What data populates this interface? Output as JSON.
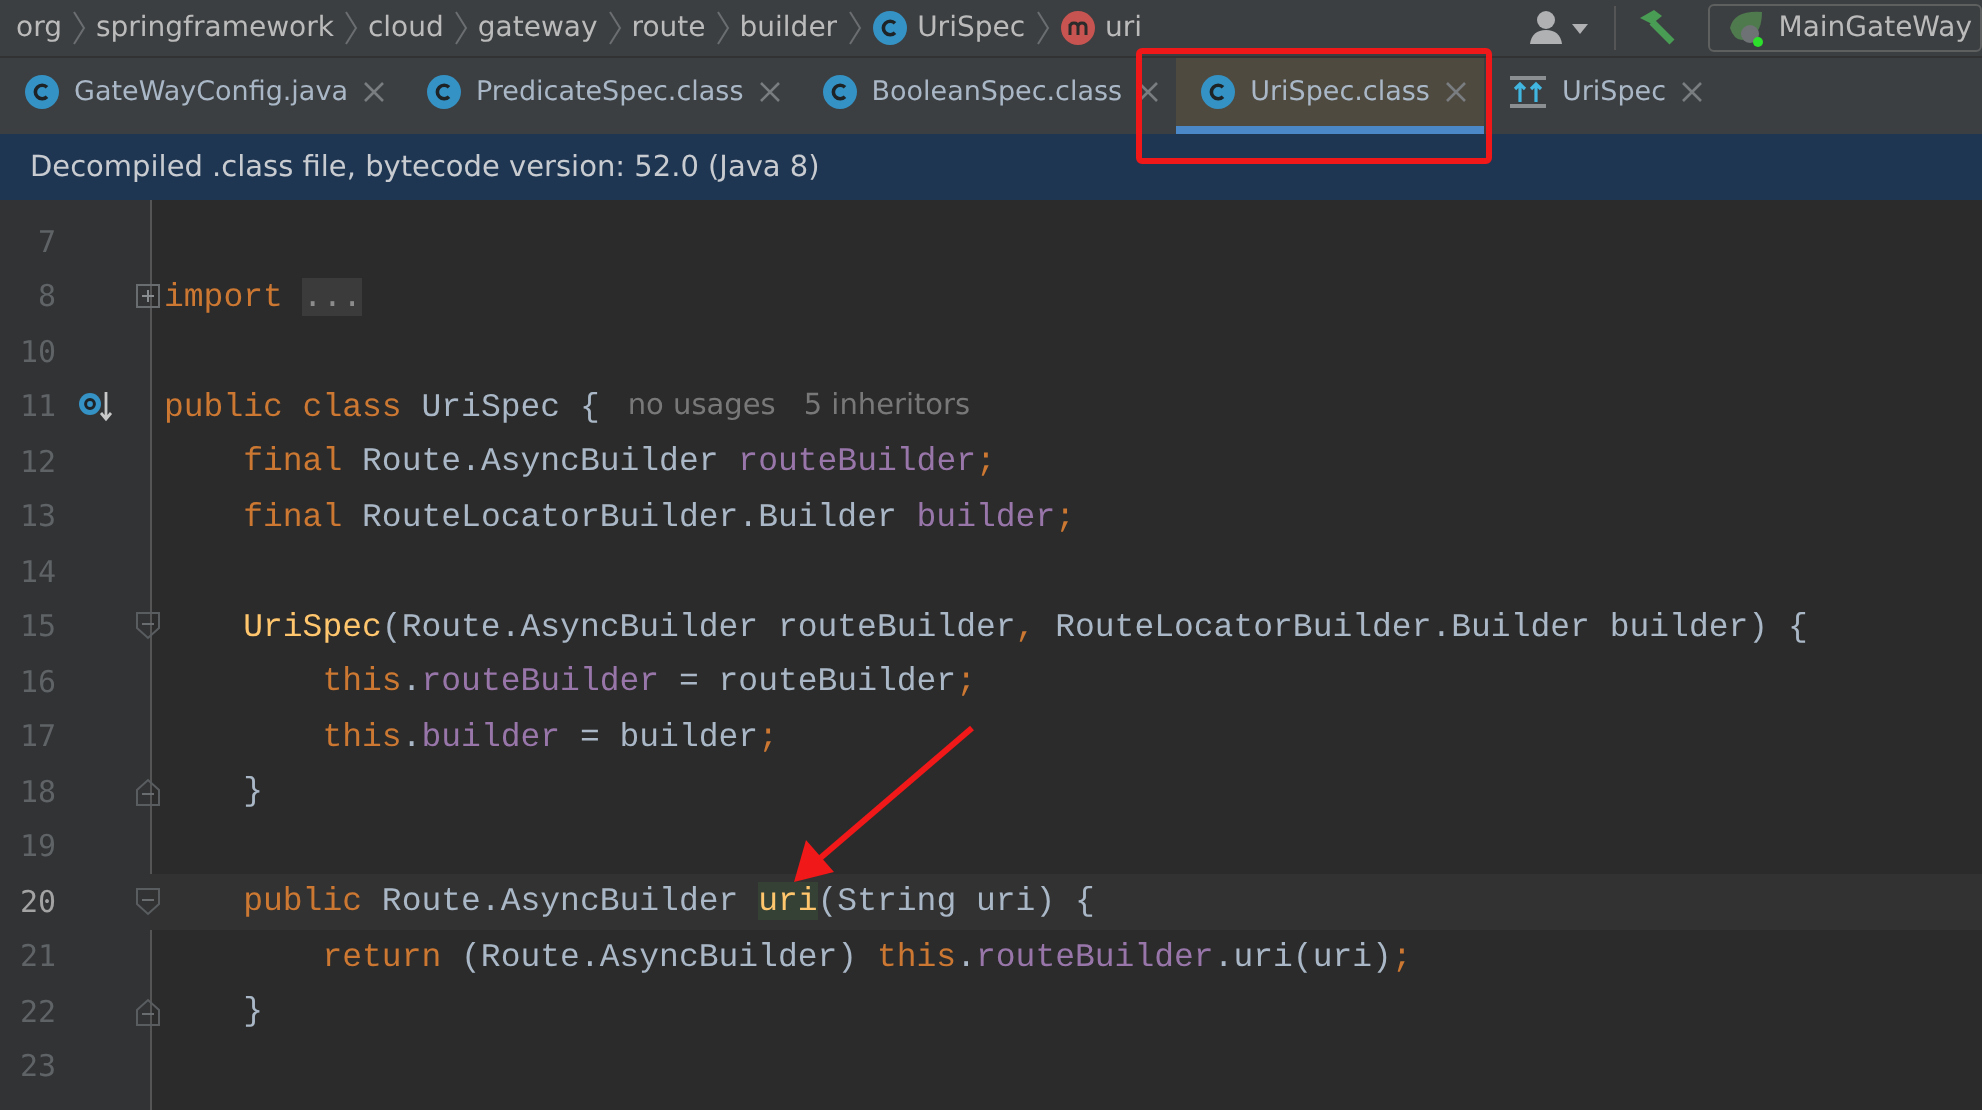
{
  "breadcrumbs": [
    {
      "label": "org"
    },
    {
      "label": "springframework"
    },
    {
      "label": "cloud"
    },
    {
      "label": "gateway"
    },
    {
      "label": "route"
    },
    {
      "label": "builder"
    },
    {
      "label": "UriSpec",
      "kind": "class"
    },
    {
      "label": "uri",
      "kind": "method"
    }
  ],
  "run_config": {
    "label": "MainGateWay"
  },
  "tabs": [
    {
      "label": "GateWayConfig.java",
      "kind": "class",
      "selected": false,
      "outlined": false
    },
    {
      "label": "PredicateSpec.class",
      "kind": "class",
      "selected": false,
      "outlined": false
    },
    {
      "label": "BooleanSpec.class",
      "kind": "class",
      "selected": false,
      "outlined": false
    },
    {
      "label": "UriSpec.class",
      "kind": "class",
      "selected": true,
      "outlined": true
    },
    {
      "label": "UriSpec",
      "kind": "structure",
      "selected": false,
      "outlined": false
    }
  ],
  "banner": "Decompiled .class file, bytecode version: 52.0 (Java 8)",
  "code_lines": [
    {
      "number": "7",
      "current": false,
      "kind": "plain"
    },
    {
      "number": "8",
      "current": false,
      "kind": "fold_plus",
      "tokens": [
        {
          "kind": "keyword",
          "text": "import "
        },
        {
          "kind": "folded",
          "text": "..."
        }
      ]
    },
    {
      "number": "10",
      "current": false,
      "kind": "plain"
    },
    {
      "number": "11",
      "current": false,
      "kind": "implemented",
      "tokens": [
        {
          "kind": "keyword",
          "text": "public class "
        },
        {
          "kind": "plain",
          "text": "UriSpec {"
        }
      ],
      "hints": [
        "no usages",
        "5 inheritors"
      ]
    },
    {
      "number": "12",
      "current": false,
      "kind": "plain",
      "tokens": [
        {
          "kind": "keyword",
          "text": "    final "
        },
        {
          "kind": "plain",
          "text": "Route.AsyncBuilder "
        },
        {
          "kind": "field",
          "text": "routeBuilder"
        },
        {
          "kind": "keyword",
          "text": ";"
        }
      ]
    },
    {
      "number": "13",
      "current": false,
      "kind": "plain",
      "tokens": [
        {
          "kind": "keyword",
          "text": "    final "
        },
        {
          "kind": "plain",
          "text": "RouteLocatorBuilder.Builder "
        },
        {
          "kind": "field",
          "text": "builder"
        },
        {
          "kind": "keyword",
          "text": ";"
        }
      ]
    },
    {
      "number": "14",
      "current": false,
      "kind": "plain"
    },
    {
      "number": "15",
      "current": false,
      "kind": "fold_start",
      "tokens": [
        {
          "kind": "method",
          "text": "    UriSpec"
        },
        {
          "kind": "plain",
          "text": "(Route.AsyncBuilder routeBuilder"
        },
        {
          "kind": "keyword",
          "text": ", "
        },
        {
          "kind": "plain",
          "text": "RouteLocatorBuilder.Builder builder) {"
        }
      ]
    },
    {
      "number": "16",
      "current": false,
      "kind": "plain",
      "tokens": [
        {
          "kind": "keyword",
          "text": "        this"
        },
        {
          "kind": "plain",
          "text": "."
        },
        {
          "kind": "field",
          "text": "routeBuilder"
        },
        {
          "kind": "plain",
          "text": " = routeBuilder"
        },
        {
          "kind": "keyword",
          "text": ";"
        }
      ]
    },
    {
      "number": "17",
      "current": false,
      "kind": "plain",
      "tokens": [
        {
          "kind": "keyword",
          "text": "        this"
        },
        {
          "kind": "plain",
          "text": "."
        },
        {
          "kind": "field",
          "text": "builder"
        },
        {
          "kind": "plain",
          "text": " = builder"
        },
        {
          "kind": "keyword",
          "text": ";"
        }
      ]
    },
    {
      "number": "18",
      "current": false,
      "kind": "fold_end",
      "tokens": [
        {
          "kind": "plain",
          "text": "    }"
        }
      ]
    },
    {
      "number": "19",
      "current": false,
      "kind": "plain"
    },
    {
      "number": "20",
      "current": true,
      "kind": "fold_start",
      "tokens": [
        {
          "kind": "keyword",
          "text": "    public "
        },
        {
          "kind": "plain",
          "text": "Route.AsyncBuilder "
        },
        {
          "kind": "method_hl",
          "text": "uri"
        },
        {
          "kind": "plain",
          "text": "(String uri) {"
        }
      ]
    },
    {
      "number": "21",
      "current": false,
      "kind": "plain",
      "tokens": [
        {
          "kind": "keyword",
          "text": "        return "
        },
        {
          "kind": "plain",
          "text": "(Route.AsyncBuilder) "
        },
        {
          "kind": "keyword",
          "text": "this"
        },
        {
          "kind": "plain",
          "text": "."
        },
        {
          "kind": "field",
          "text": "routeBuilder"
        },
        {
          "kind": "plain",
          "text": ".uri(uri)"
        },
        {
          "kind": "keyword",
          "text": ";"
        }
      ]
    },
    {
      "number": "22",
      "current": false,
      "kind": "fold_end",
      "tokens": [
        {
          "kind": "plain",
          "text": "    }"
        }
      ]
    },
    {
      "number": "23",
      "current": false,
      "kind": "plain"
    }
  ]
}
